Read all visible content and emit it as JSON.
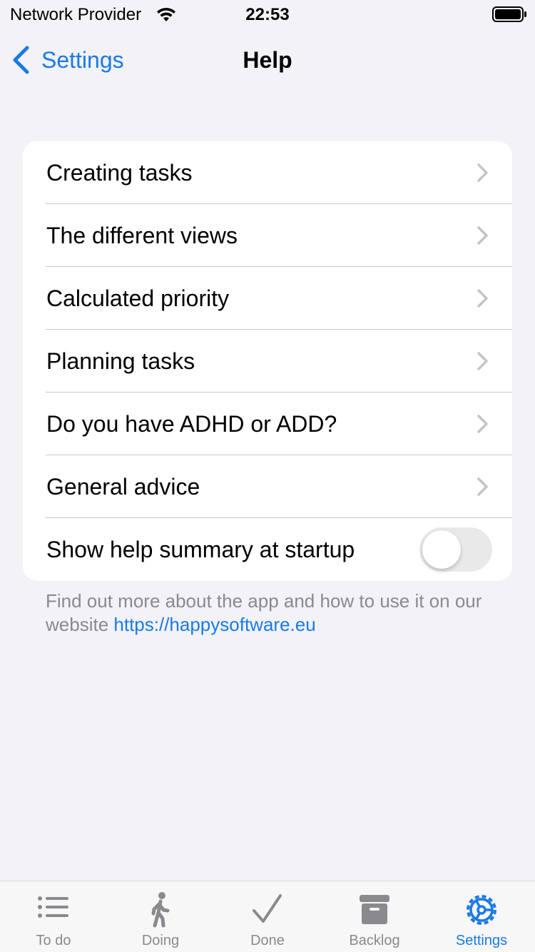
{
  "status_bar": {
    "carrier": "Network Provider",
    "time": "22:53"
  },
  "nav": {
    "back_label": "Settings",
    "title": "Help"
  },
  "help_items": [
    {
      "label": "Creating tasks"
    },
    {
      "label": "The different views"
    },
    {
      "label": "Calculated priority"
    },
    {
      "label": "Planning tasks"
    },
    {
      "label": "Do you have ADHD or ADD?"
    },
    {
      "label": "General advice"
    }
  ],
  "startup_toggle": {
    "label": "Show help summary at startup",
    "on": false
  },
  "footer": {
    "text": "Find out more about the app and how to use it on our website ",
    "link": "https://happysoftware.eu"
  },
  "tabs": [
    {
      "label": "To do",
      "icon": "list-icon",
      "active": false
    },
    {
      "label": "Doing",
      "icon": "walking-icon",
      "active": false
    },
    {
      "label": "Done",
      "icon": "checkmark-icon",
      "active": false
    },
    {
      "label": "Backlog",
      "icon": "archive-icon",
      "active": false
    },
    {
      "label": "Settings",
      "icon": "gear-icon",
      "active": true
    }
  ],
  "colors": {
    "accent": "#1a7ae6",
    "background": "#f2f2f7",
    "inactive_tab": "#8a8a8e"
  }
}
